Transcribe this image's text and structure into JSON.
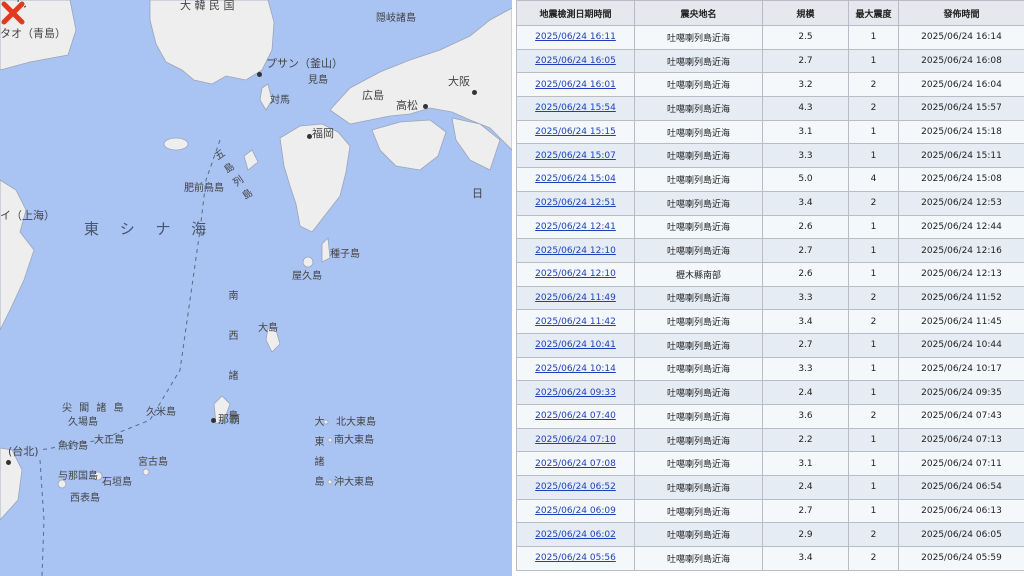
{
  "map": {
    "labels": {
      "korea": "大 韓 民 国",
      "qingdao": "タオ（青島）",
      "busan": "プサン（釜山）",
      "ulleung": "隠岐諸島",
      "mishima": "見島",
      "tsushima": "対馬",
      "hiroshima": "広島",
      "takamatsu": "高松",
      "osaka": "大阪",
      "fukuoka": "福岡",
      "goto": "五島列島",
      "hizen": "肥前鳥島",
      "shanghai": "イ（上海）",
      "ecs": "東 シ ナ 海",
      "tanegashima": "種子島",
      "yakushima": "屋久島",
      "amami": "大島",
      "naha": "那覇",
      "kume": "久米島",
      "senkaku": "尖 閣 諸 島",
      "uotsuri": "魚釣島",
      "taisho": "大正島",
      "kuba": "久場島",
      "miyako": "宮古島",
      "yonaguni": "与那国島",
      "ishigaki": "石垣島",
      "iriomote": "西表島",
      "taipei": "(台北)",
      "kitadaito": "北大東島",
      "minamidaito": "南大東島",
      "okidaito": "沖大東島",
      "daito": "大東諸島",
      "nansei": "南西諸島",
      "nihon": "日"
    }
  },
  "table": {
    "headers": [
      "地震檢測日期時間",
      "震央地名",
      "規模",
      "最大震度",
      "發佈時間"
    ],
    "rows": [
      {
        "detect": "2025/06/24 16:11",
        "place": "吐噶喇列島近海",
        "mag": "2.5",
        "intensity": "1",
        "published": "2025/06/24 16:14"
      },
      {
        "detect": "2025/06/24 16:05",
        "place": "吐噶喇列島近海",
        "mag": "2.7",
        "intensity": "1",
        "published": "2025/06/24 16:08"
      },
      {
        "detect": "2025/06/24 16:01",
        "place": "吐噶喇列島近海",
        "mag": "3.2",
        "intensity": "2",
        "published": "2025/06/24 16:04"
      },
      {
        "detect": "2025/06/24 15:54",
        "place": "吐噶喇列島近海",
        "mag": "4.3",
        "intensity": "2",
        "published": "2025/06/24 15:57"
      },
      {
        "detect": "2025/06/24 15:15",
        "place": "吐噶喇列島近海",
        "mag": "3.1",
        "intensity": "1",
        "published": "2025/06/24 15:18"
      },
      {
        "detect": "2025/06/24 15:07",
        "place": "吐噶喇列島近海",
        "mag": "3.3",
        "intensity": "1",
        "published": "2025/06/24 15:11"
      },
      {
        "detect": "2025/06/24 15:04",
        "place": "吐噶喇列島近海",
        "mag": "5.0",
        "intensity": "4",
        "published": "2025/06/24 15:08"
      },
      {
        "detect": "2025/06/24 12:51",
        "place": "吐噶喇列島近海",
        "mag": "3.4",
        "intensity": "2",
        "published": "2025/06/24 12:53"
      },
      {
        "detect": "2025/06/24 12:41",
        "place": "吐噶喇列島近海",
        "mag": "2.6",
        "intensity": "1",
        "published": "2025/06/24 12:44"
      },
      {
        "detect": "2025/06/24 12:10",
        "place": "吐噶喇列島近海",
        "mag": "2.7",
        "intensity": "1",
        "published": "2025/06/24 12:16"
      },
      {
        "detect": "2025/06/24 12:10",
        "place": "櫪木縣南部",
        "mag": "2.6",
        "intensity": "1",
        "published": "2025/06/24 12:13"
      },
      {
        "detect": "2025/06/24 11:49",
        "place": "吐噶喇列島近海",
        "mag": "3.3",
        "intensity": "2",
        "published": "2025/06/24 11:52"
      },
      {
        "detect": "2025/06/24 11:42",
        "place": "吐噶喇列島近海",
        "mag": "3.4",
        "intensity": "2",
        "published": "2025/06/24 11:45"
      },
      {
        "detect": "2025/06/24 10:41",
        "place": "吐噶喇列島近海",
        "mag": "2.7",
        "intensity": "1",
        "published": "2025/06/24 10:44"
      },
      {
        "detect": "2025/06/24 10:14",
        "place": "吐噶喇列島近海",
        "mag": "3.3",
        "intensity": "1",
        "published": "2025/06/24 10:17"
      },
      {
        "detect": "2025/06/24 09:33",
        "place": "吐噶喇列島近海",
        "mag": "2.4",
        "intensity": "1",
        "published": "2025/06/24 09:35"
      },
      {
        "detect": "2025/06/24 07:40",
        "place": "吐噶喇列島近海",
        "mag": "3.6",
        "intensity": "2",
        "published": "2025/06/24 07:43"
      },
      {
        "detect": "2025/06/24 07:10",
        "place": "吐噶喇列島近海",
        "mag": "2.2",
        "intensity": "1",
        "published": "2025/06/24 07:13"
      },
      {
        "detect": "2025/06/24 07:08",
        "place": "吐噶喇列島近海",
        "mag": "3.1",
        "intensity": "1",
        "published": "2025/06/24 07:11"
      },
      {
        "detect": "2025/06/24 06:52",
        "place": "吐噶喇列島近海",
        "mag": "2.4",
        "intensity": "1",
        "published": "2025/06/24 06:54"
      },
      {
        "detect": "2025/06/24 06:09",
        "place": "吐噶喇列島近海",
        "mag": "2.7",
        "intensity": "1",
        "published": "2025/06/24 06:13"
      },
      {
        "detect": "2025/06/24 06:02",
        "place": "吐噶喇列島近海",
        "mag": "2.9",
        "intensity": "2",
        "published": "2025/06/24 06:05"
      },
      {
        "detect": "2025/06/24 05:56",
        "place": "吐噶喇列島近海",
        "mag": "3.4",
        "intensity": "2",
        "published": "2025/06/24 05:59"
      }
    ]
  },
  "colors": {
    "sea": "#a9c3f2",
    "land": "#eeeeee",
    "link": "#1f3fb8",
    "marker": "#e23a1c"
  }
}
